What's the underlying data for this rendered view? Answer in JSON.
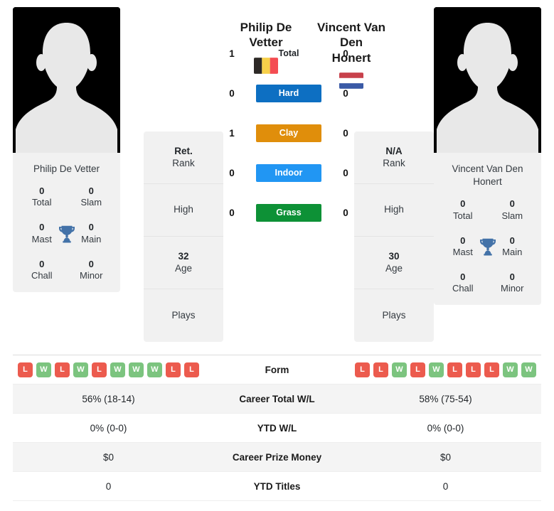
{
  "players": {
    "left": {
      "name": "Philip De Vetter",
      "name_line1": "Philip De",
      "name_line2": "Vetter",
      "country": "Belgium",
      "flag": "belgium-flag",
      "rank": "Ret.",
      "rank_label": "Rank",
      "high": "",
      "high_label": "High",
      "age": "32",
      "age_label": "Age",
      "plays": "",
      "plays_label": "Plays",
      "titles": [
        {
          "value": "0",
          "label": "Total"
        },
        {
          "value": "0",
          "label": "Slam"
        },
        {
          "value": "0",
          "label": "Mast"
        },
        {
          "value": "0",
          "label": "Main"
        },
        {
          "value": "0",
          "label": "Chall"
        },
        {
          "value": "0",
          "label": "Minor"
        }
      ],
      "form": [
        "L",
        "W",
        "L",
        "W",
        "L",
        "W",
        "W",
        "W",
        "L",
        "L"
      ],
      "career_total_wl": "56% (18-14)",
      "ytd_wl": "0% (0-0)",
      "career_prize_money": "$0",
      "ytd_titles": "0"
    },
    "right": {
      "name": "Vincent Van Den Honert",
      "name_line1": "Vincent Van Den",
      "name_line2": "Honert",
      "country": "Netherlands",
      "flag": "netherlands-flag",
      "rank": "N/A",
      "rank_label": "Rank",
      "high": "",
      "high_label": "High",
      "age": "30",
      "age_label": "Age",
      "plays": "",
      "plays_label": "Plays",
      "titles": [
        {
          "value": "0",
          "label": "Total"
        },
        {
          "value": "0",
          "label": "Slam"
        },
        {
          "value": "0",
          "label": "Mast"
        },
        {
          "value": "0",
          "label": "Main"
        },
        {
          "value": "0",
          "label": "Chall"
        },
        {
          "value": "0",
          "label": "Minor"
        }
      ],
      "form": [
        "L",
        "L",
        "W",
        "L",
        "W",
        "L",
        "L",
        "L",
        "W",
        "W"
      ],
      "career_total_wl": "58% (75-54)",
      "ytd_wl": "0% (0-0)",
      "career_prize_money": "$0",
      "ytd_titles": "0"
    }
  },
  "head_to_head": [
    {
      "label": "Total",
      "left": "1",
      "right": "0",
      "color": "",
      "plain": true
    },
    {
      "label": "Hard",
      "left": "0",
      "right": "0",
      "color": "#0d6fc2",
      "plain": false
    },
    {
      "label": "Clay",
      "left": "1",
      "right": "0",
      "color": "#e08e0b",
      "plain": false
    },
    {
      "label": "Indoor",
      "left": "0",
      "right": "0",
      "color": "#2196f3",
      "plain": false
    },
    {
      "label": "Grass",
      "left": "0",
      "right": "0",
      "color": "#0d9136",
      "plain": false
    }
  ],
  "comparison_rows": [
    {
      "label": "Form",
      "left": "",
      "right": ""
    },
    {
      "label": "Career Total W/L",
      "left": "56% (18-14)",
      "right": "58% (75-54)"
    },
    {
      "label": "YTD W/L",
      "left": "0% (0-0)",
      "right": "0% (0-0)"
    },
    {
      "label": "Career Prize Money",
      "left": "$0",
      "right": "$0"
    },
    {
      "label": "YTD Titles",
      "left": "0",
      "right": "0"
    }
  ],
  "colors": {
    "hard": "#0d6fc2",
    "clay": "#e08e0b",
    "indoor": "#2196f3",
    "grass": "#0d9136",
    "win": "#7cc47f",
    "loss": "#ec5b4e",
    "trophy": "#4372a8",
    "card_bg": "#f1f1f1"
  }
}
